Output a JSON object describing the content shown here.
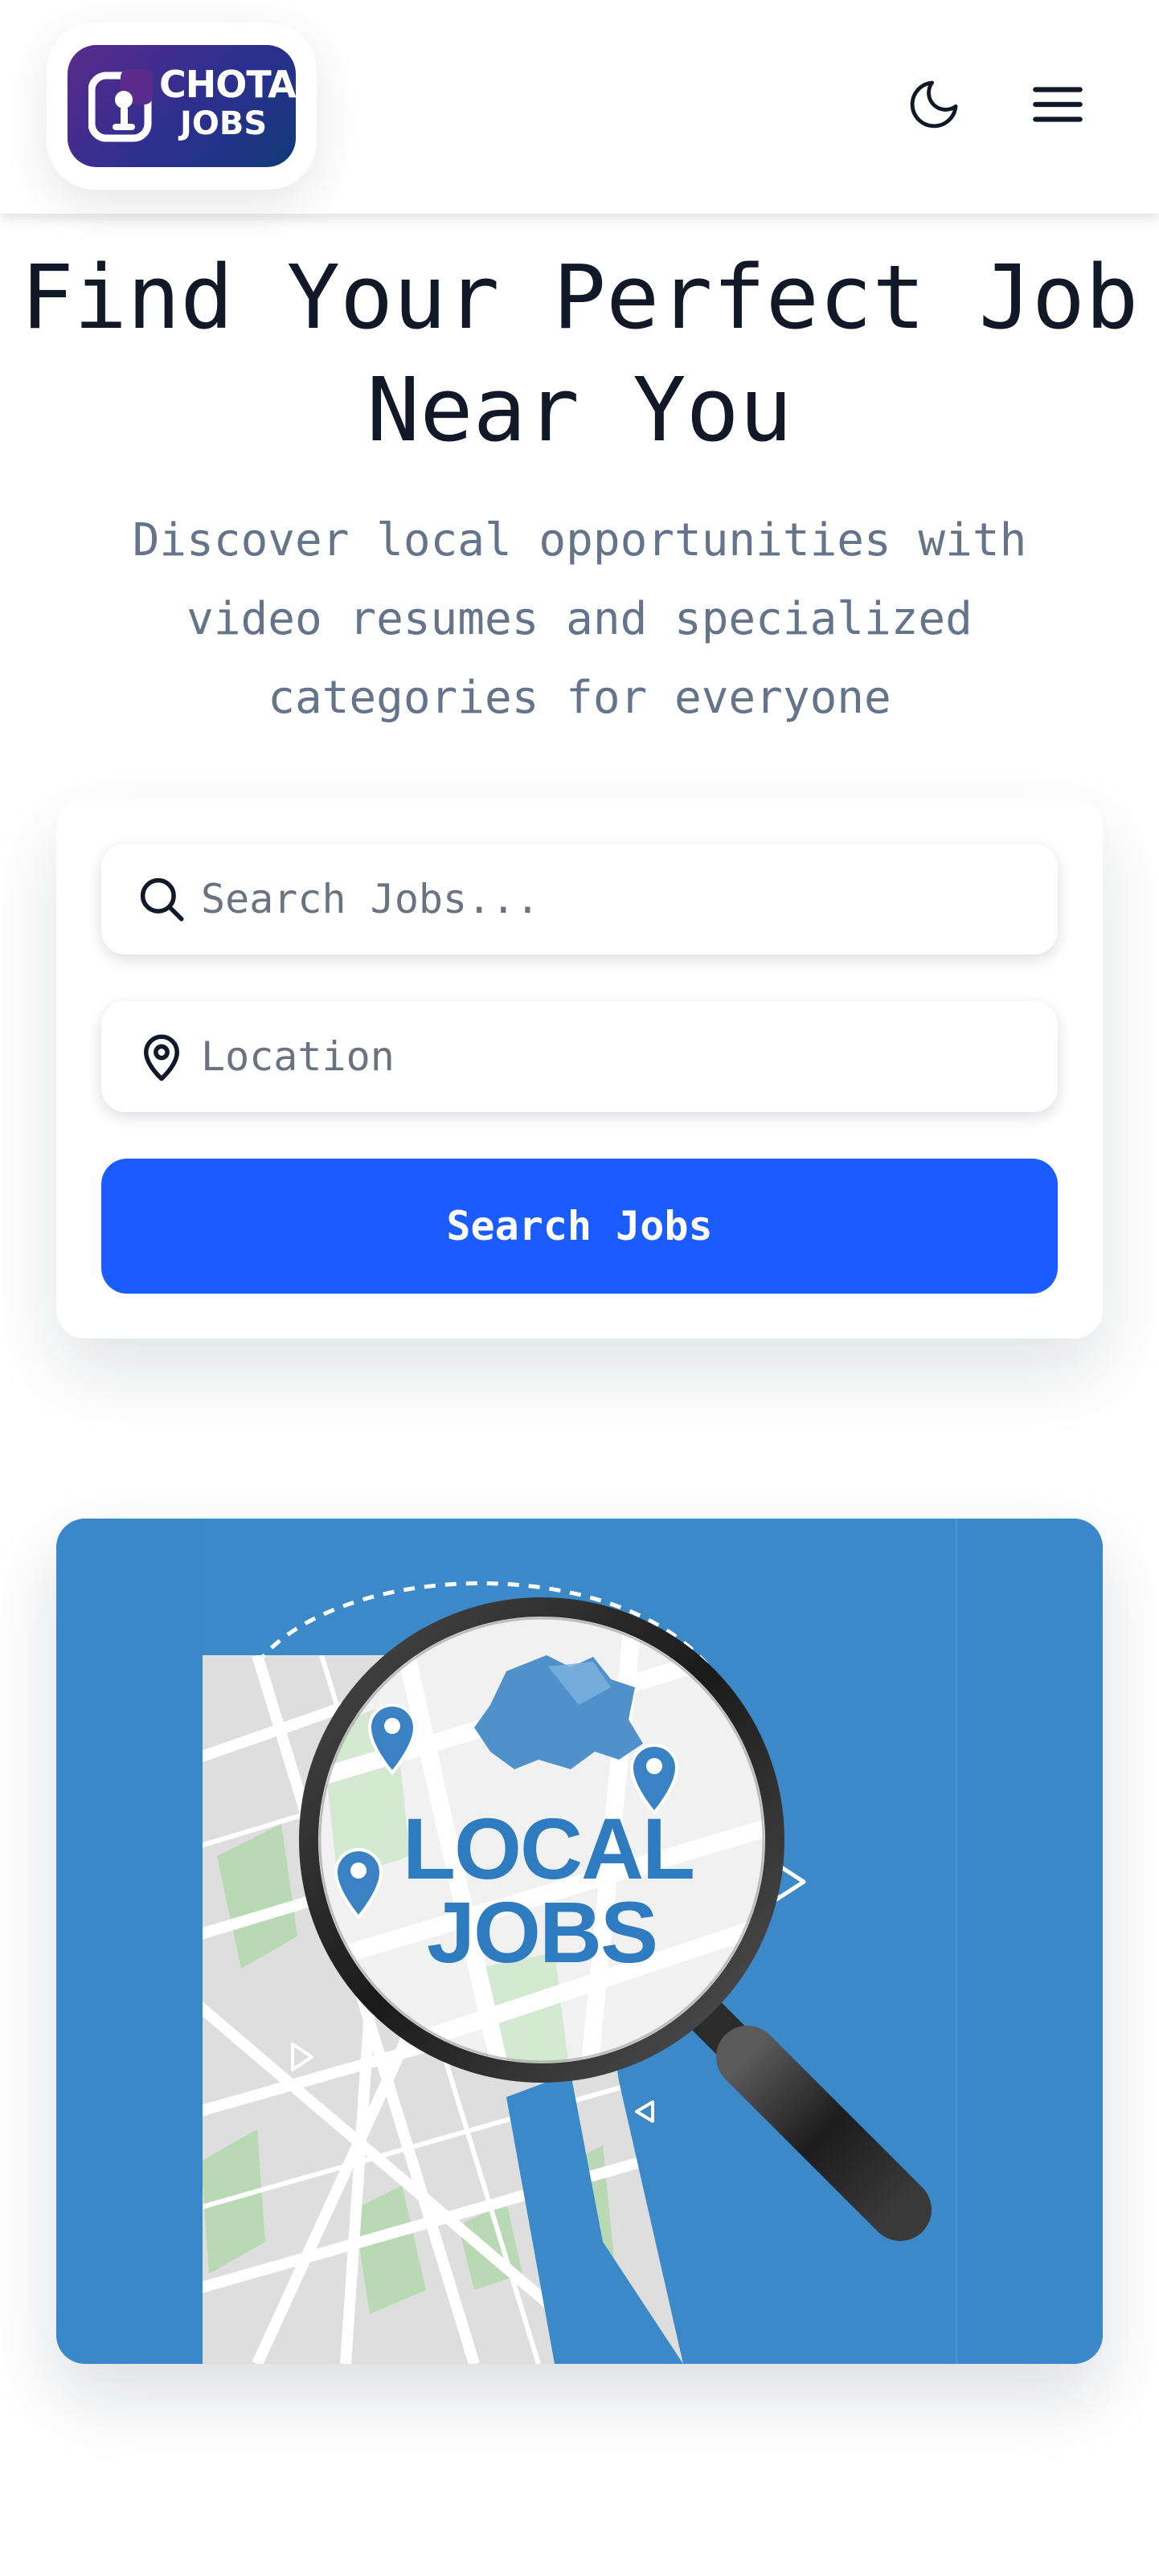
{
  "header": {
    "logo": {
      "line1": "CHOTA",
      "line2": "JOBS"
    },
    "theme_toggle_icon": "moon-icon",
    "menu_icon": "hamburger-menu-icon"
  },
  "hero": {
    "title": "Find Your Perfect Job Near You",
    "subtitle": "Discover local opportunities with video resumes and specialized categories for everyone"
  },
  "search": {
    "keyword_placeholder": "Search Jobs...",
    "keyword_icon": "search-icon",
    "location_placeholder": "Location",
    "location_icon": "map-pin-icon",
    "button_label": "Search Jobs"
  },
  "promo": {
    "line1": "LOCAL",
    "line2": "JOBS"
  },
  "colors": {
    "primary": "#1a5cff",
    "promo_bg": "#3a88c9",
    "logo_gradient_start": "#5b2b8c",
    "logo_gradient_end": "#123a7a"
  }
}
